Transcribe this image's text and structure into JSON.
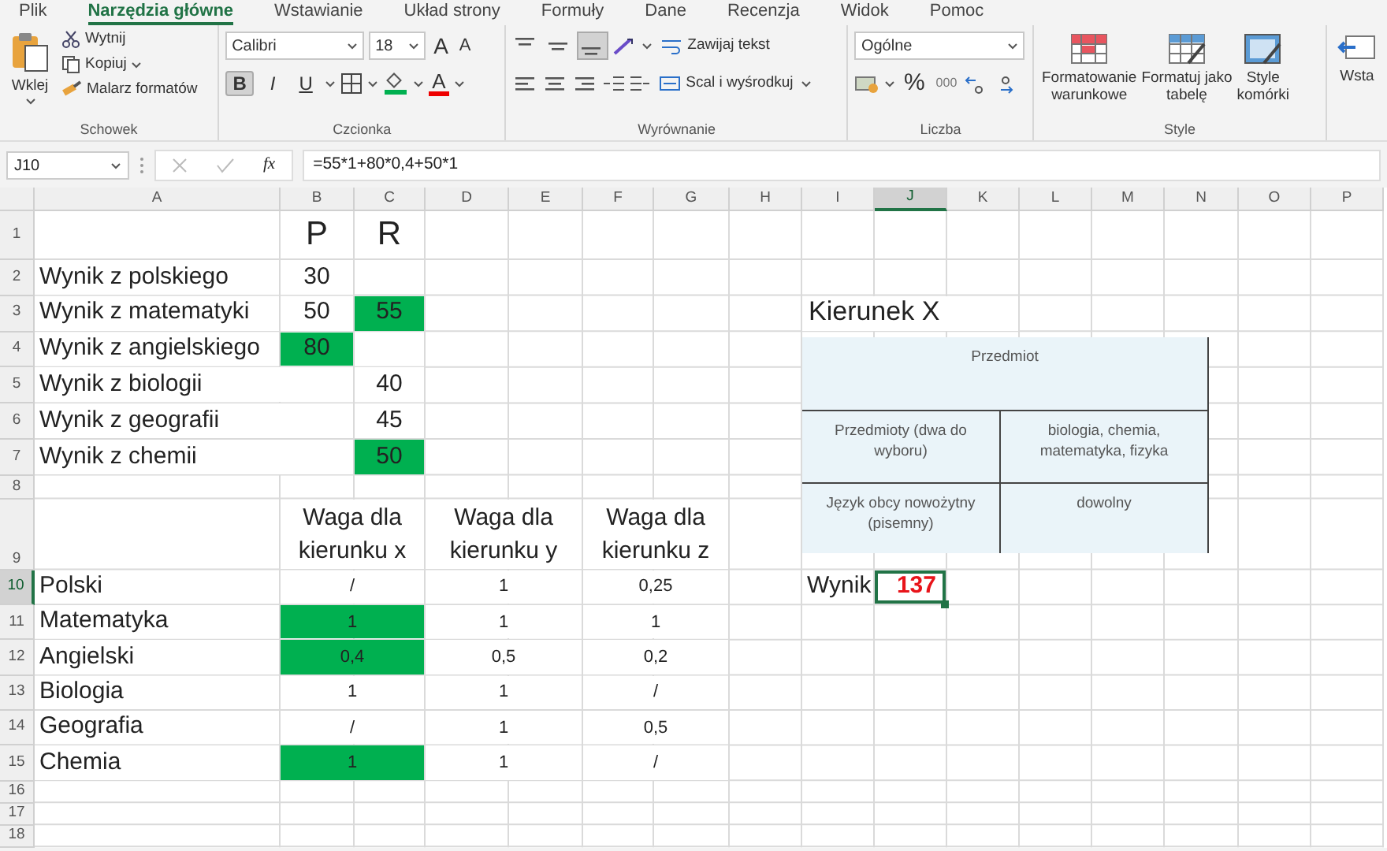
{
  "menu_tabs": [
    {
      "label": "Plik",
      "selected": false
    },
    {
      "label": "Narzędzia główne",
      "selected": true
    },
    {
      "label": "Wstawianie",
      "selected": false
    },
    {
      "label": "Układ strony",
      "selected": false
    },
    {
      "label": "Formuły",
      "selected": false
    },
    {
      "label": "Dane",
      "selected": false
    },
    {
      "label": "Recenzja",
      "selected": false
    },
    {
      "label": "Widok",
      "selected": false
    },
    {
      "label": "Pomoc",
      "selected": false
    }
  ],
  "clipboard": {
    "label": "Schowek",
    "paste": "Wklej",
    "cut": "Wytnij",
    "copy": "Kopiuj",
    "painter": "Malarz formatów"
  },
  "font": {
    "label": "Czcionka",
    "name": "Calibri",
    "size": "18",
    "grow": "A",
    "shrink": "A",
    "bold": {
      "text": "B",
      "selected": true
    },
    "italic": {
      "text": "I",
      "selected": false
    },
    "underline": {
      "text": "U",
      "selected": false
    },
    "font_color": "A"
  },
  "alignment": {
    "label": "Wyrównanie",
    "vertical": [
      {
        "selected": false
      },
      {
        "selected": false
      },
      {
        "selected": true
      }
    ],
    "wrap": "Zawijaj tekst",
    "merge": "Scal i wyśrodkuj"
  },
  "number": {
    "label": "Liczba",
    "format": "Ogólne",
    "percent": "%",
    "thousands": "000"
  },
  "styles": {
    "label": "Style",
    "buttons": [
      [
        "Formatowanie",
        "warunkowe"
      ],
      [
        "Formatuj jako",
        "tabelę"
      ],
      [
        "Style",
        "komórki"
      ]
    ]
  },
  "cells_group": {
    "button": "Wsta"
  },
  "formula_bar": {
    "name_box": "J10",
    "fx": "fx",
    "formula": "=55*1+80*0,4+50*1"
  },
  "columns": [
    {
      "label": "A",
      "selected": false
    },
    {
      "label": "B",
      "selected": false
    },
    {
      "label": "C",
      "selected": false
    },
    {
      "label": "D",
      "selected": false
    },
    {
      "label": "E",
      "selected": false
    },
    {
      "label": "F",
      "selected": false
    },
    {
      "label": "G",
      "selected": false
    },
    {
      "label": "H",
      "selected": false
    },
    {
      "label": "I",
      "selected": false
    },
    {
      "label": "J",
      "selected": true
    },
    {
      "label": "K",
      "selected": false
    },
    {
      "label": "L",
      "selected": false
    },
    {
      "label": "M",
      "selected": false
    },
    {
      "label": "N",
      "selected": false
    },
    {
      "label": "O",
      "selected": false
    },
    {
      "label": "P",
      "selected": false
    }
  ],
  "rows": [
    {
      "number": "1",
      "kind": "title",
      "selected": false,
      "cells": {
        "B": {
          "kind": "value",
          "text": "P",
          "highlighted": false,
          "selected": false
        },
        "C": {
          "kind": "value",
          "text": "R",
          "highlighted": false,
          "selected": false
        }
      }
    },
    {
      "number": "2",
      "kind": "score",
      "selected": false,
      "cells": {
        "A": {
          "kind": "label",
          "text": "Wynik z polskiego",
          "highlighted": false,
          "selected": false
        },
        "B": {
          "kind": "value",
          "text": "30",
          "highlighted": false,
          "selected": false
        }
      }
    },
    {
      "number": "3",
      "kind": "score",
      "selected": false,
      "cells": {
        "A": {
          "kind": "label",
          "text": "Wynik z matematyki",
          "highlighted": false,
          "selected": false
        },
        "B": {
          "kind": "value",
          "text": "50",
          "highlighted": false,
          "selected": false
        },
        "C": {
          "kind": "value",
          "text": "55",
          "highlighted": true,
          "selected": false
        },
        "I": {
          "kind": "caption",
          "text": "Kierunek X",
          "highlighted": false,
          "selected": false
        }
      }
    },
    {
      "number": "4",
      "kind": "score",
      "selected": false,
      "cells": {
        "A": {
          "kind": "label",
          "text": "Wynik z angielskiego",
          "highlighted": false,
          "selected": false
        },
        "B": {
          "kind": "value",
          "text": "80",
          "highlighted": true,
          "selected": false
        }
      }
    },
    {
      "number": "5",
      "kind": "score",
      "selected": false,
      "cells": {
        "A": {
          "kind": "label",
          "text": "Wynik z biologii",
          "highlighted": false,
          "selected": false
        },
        "C": {
          "kind": "value",
          "text": "40",
          "highlighted": false,
          "selected": false
        }
      }
    },
    {
      "number": "6",
      "kind": "score",
      "selected": false,
      "cells": {
        "A": {
          "kind": "label",
          "text": "Wynik z geografii",
          "highlighted": false,
          "selected": false
        },
        "C": {
          "kind": "value",
          "text": "45",
          "highlighted": false,
          "selected": false
        }
      }
    },
    {
      "number": "7",
      "kind": "score",
      "selected": false,
      "cells": {
        "A": {
          "kind": "label",
          "text": "Wynik z chemii",
          "highlighted": false,
          "selected": false
        },
        "C": {
          "kind": "value",
          "text": "50",
          "highlighted": true,
          "selected": false
        }
      }
    },
    {
      "number": "8",
      "kind": "spacer",
      "selected": false,
      "cells": {}
    },
    {
      "number": "9",
      "kind": "heading",
      "selected": false,
      "cells": {
        "B:C": {
          "kind": "value",
          "text": "Waga dla kierunku x",
          "highlighted": false,
          "selected": false
        },
        "D:E": {
          "kind": "value",
          "text": "Waga dla kierunku y",
          "highlighted": false,
          "selected": false
        },
        "F:G": {
          "kind": "value",
          "text": "Waga dla kierunku z",
          "highlighted": false,
          "selected": false
        }
      }
    },
    {
      "number": "10",
      "kind": "weight",
      "selected": true,
      "cells": {
        "A": {
          "kind": "label",
          "text": "Polski",
          "highlighted": false,
          "selected": false
        },
        "B:C": {
          "kind": "value",
          "text": "/",
          "highlighted": false,
          "selected": false
        },
        "D:E": {
          "kind": "value",
          "text": "1",
          "highlighted": false,
          "selected": false
        },
        "F:G": {
          "kind": "value",
          "text": "0,25",
          "highlighted": false,
          "selected": false
        },
        "I": {
          "kind": "label",
          "text": "Wynik",
          "highlighted": false,
          "selected": false
        },
        "J": {
          "kind": "result",
          "text": "137",
          "highlighted": false,
          "selected": true
        }
      }
    },
    {
      "number": "11",
      "kind": "weight",
      "selected": false,
      "cells": {
        "A": {
          "kind": "label",
          "text": "Matematyka",
          "highlighted": false,
          "selected": false
        },
        "B:C": {
          "kind": "value",
          "text": "1",
          "highlighted": true,
          "selected": false
        },
        "D:E": {
          "kind": "value",
          "text": "1",
          "highlighted": false,
          "selected": false
        },
        "F:G": {
          "kind": "value",
          "text": "1",
          "highlighted": false,
          "selected": false
        }
      }
    },
    {
      "number": "12",
      "kind": "weight",
      "selected": false,
      "cells": {
        "A": {
          "kind": "label",
          "text": "Angielski",
          "highlighted": false,
          "selected": false
        },
        "B:C": {
          "kind": "value",
          "text": "0,4",
          "highlighted": true,
          "selected": false
        },
        "D:E": {
          "kind": "value",
          "text": "0,5",
          "highlighted": false,
          "selected": false
        },
        "F:G": {
          "kind": "value",
          "text": "0,2",
          "highlighted": false,
          "selected": false
        }
      }
    },
    {
      "number": "13",
      "kind": "weight",
      "selected": false,
      "cells": {
        "A": {
          "kind": "label",
          "text": "Biologia",
          "highlighted": false,
          "selected": false
        },
        "B:C": {
          "kind": "value",
          "text": "1",
          "highlighted": false,
          "selected": false
        },
        "D:E": {
          "kind": "value",
          "text": "1",
          "highlighted": false,
          "selected": false
        },
        "F:G": {
          "kind": "value",
          "text": "/",
          "highlighted": false,
          "selected": false
        }
      }
    },
    {
      "number": "14",
      "kind": "weight",
      "selected": false,
      "cells": {
        "A": {
          "kind": "label",
          "text": "Geografia",
          "highlighted": false,
          "selected": false
        },
        "B:C": {
          "kind": "value",
          "text": "/",
          "highlighted": false,
          "selected": false
        },
        "D:E": {
          "kind": "value",
          "text": "1",
          "highlighted": false,
          "selected": false
        },
        "F:G": {
          "kind": "value",
          "text": "0,5",
          "highlighted": false,
          "selected": false
        }
      }
    },
    {
      "number": "15",
      "kind": "weight",
      "selected": false,
      "cells": {
        "A": {
          "kind": "label",
          "text": "Chemia",
          "highlighted": false,
          "selected": false
        },
        "B:C": {
          "kind": "value",
          "text": "1",
          "highlighted": true,
          "selected": false
        },
        "D:E": {
          "kind": "value",
          "text": "1",
          "highlighted": false,
          "selected": false
        },
        "F:G": {
          "kind": "value",
          "text": "/",
          "highlighted": false,
          "selected": false
        }
      }
    },
    {
      "number": "16",
      "kind": "spacer",
      "selected": false,
      "cells": {}
    },
    {
      "number": "17",
      "kind": "spacer",
      "selected": false,
      "cells": {}
    },
    {
      "number": "18",
      "kind": "spacer",
      "selected": false,
      "cells": {}
    }
  ],
  "embedded_table": {
    "rows": [
      [
        "Przedmiot"
      ],
      [
        "Przedmioty (dwa do wyboru)",
        "biologia, chemia, matematyka, fizyka"
      ],
      [
        "Język obcy nowożytny (pisemny)",
        "dowolny"
      ]
    ]
  }
}
